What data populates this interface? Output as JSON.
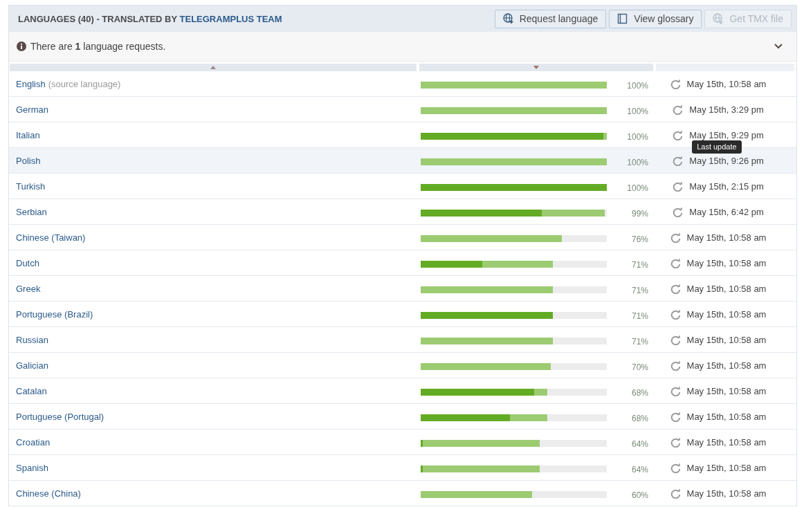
{
  "header": {
    "title": "LANGUAGES (40) - TRANSLATED BY",
    "team": "TELEGRAMPLUS TEAM",
    "buttons": [
      {
        "label": "Request language",
        "kind": "request",
        "disabled": false
      },
      {
        "label": "View glossary",
        "kind": "glossary",
        "disabled": false
      },
      {
        "label": "Get TMX file",
        "kind": "tmx",
        "disabled": true
      }
    ]
  },
  "notice": {
    "text": "There are **1** language requests.",
    "expanded": false
  },
  "columns": [
    {
      "sorted": true,
      "descending": false
    },
    {
      "sorted": true,
      "descending": true
    },
    {
      "sorted": false
    }
  ],
  "rows": [
    {
      "name": "English",
      "note": "(source language)",
      "translated": {
        "level": 1
      },
      "percent": "100%",
      "updated": "May 15th, 10:58 am",
      "highlighted": false
    },
    {
      "name": "German",
      "translated": {
        "level": 1
      },
      "percent": "100%",
      "updated": "May 15th, 3:29 pm",
      "highlighted": false
    },
    {
      "name": "Italian",
      "approved": {
        "level": 0.98
      },
      "translated": {
        "level": 1
      },
      "percent": "100%",
      "updated": "May 15th, 9:29 pm",
      "highlighted": false
    },
    {
      "name": "Polish",
      "translated": {
        "level": 1
      },
      "percent": "100%",
      "updated": "May 15th, 9:26 pm",
      "highlighted": true,
      "tooltip": "Last update"
    },
    {
      "name": "Turkish",
      "approved": {
        "level": 1
      },
      "percent": "100%",
      "updated": "May 15th, 2:15 pm",
      "highlighted": false
    },
    {
      "name": "Serbian",
      "approved": {
        "level": 0.65
      },
      "translated": {
        "level": 0.99
      },
      "percent": "99%",
      "updated": "May 15th, 6:42 pm",
      "highlighted": false
    },
    {
      "name": "Chinese (Taiwan)",
      "translated": {
        "level": 0.76
      },
      "percent": "76%",
      "updated": "May 15th, 10:58 am",
      "highlighted": false
    },
    {
      "name": "Dutch",
      "approved": {
        "level": 0.33
      },
      "translated": {
        "level": 0.71
      },
      "percent": "71%",
      "updated": "May 15th, 10:58 am",
      "highlighted": false
    },
    {
      "name": "Greek",
      "translated": {
        "level": 0.71
      },
      "percent": "71%",
      "updated": "May 15th, 10:58 am",
      "highlighted": false
    },
    {
      "name": "Portuguese (Brazil)",
      "approved": {
        "level": 0.71
      },
      "percent": "71%",
      "updated": "May 15th, 10:58 am",
      "highlighted": false
    },
    {
      "name": "Russian",
      "translated": {
        "level": 0.71
      },
      "percent": "71%",
      "updated": "May 15th, 10:58 am",
      "highlighted": false
    },
    {
      "name": "Galician",
      "translated": {
        "level": 0.7
      },
      "percent": "70%",
      "updated": "May 15th, 10:58 am",
      "highlighted": false
    },
    {
      "name": "Catalan",
      "approved": {
        "level": 0.61
      },
      "translated": {
        "level": 0.68
      },
      "percent": "68%",
      "updated": "May 15th, 10:58 am",
      "highlighted": false
    },
    {
      "name": "Portuguese (Portugal)",
      "approved": {
        "level": 0.48
      },
      "translated": {
        "level": 0.68
      },
      "percent": "68%",
      "updated": "May 15th, 10:58 am",
      "highlighted": false
    },
    {
      "name": "Croatian",
      "approved": {
        "level": 0.01
      },
      "translated": {
        "level": 0.64
      },
      "percent": "64%",
      "updated": "May 15th, 10:58 am",
      "highlighted": false
    },
    {
      "name": "Spanish",
      "approved": {
        "level": 0.01
      },
      "translated": {
        "level": 0.64
      },
      "percent": "64%",
      "updated": "May 15th, 10:58 am",
      "highlighted": false
    },
    {
      "name": "Chinese (China)",
      "translated": {
        "level": 0.6
      },
      "percent": "60%",
      "updated": "May 15th, 10:58 am",
      "highlighted": false
    }
  ]
}
